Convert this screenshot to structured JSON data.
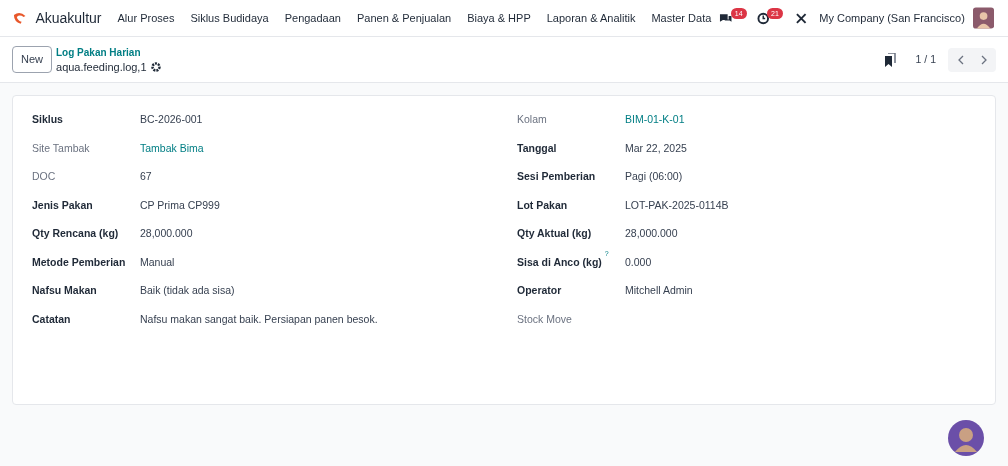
{
  "navbar": {
    "app_name": "Akuakultur",
    "menus": [
      "Alur Proses",
      "Siklus Budidaya",
      "Pengadaan",
      "Panen & Penjualan",
      "Biaya & HPP",
      "Laporan & Analitik",
      "Master Data"
    ],
    "messages_badge": "14",
    "activities_badge": "21",
    "company": "My Company (San Francisco)"
  },
  "control_panel": {
    "new_button": "New",
    "breadcrumb": "Log Pakan Harian",
    "record_name": "aqua.feeding.log,1",
    "pager": "1 / 1"
  },
  "left_fields": [
    {
      "label": "Siklus",
      "required": true,
      "value": "BC-2026-001",
      "link": false
    },
    {
      "label": "Site Tambak",
      "required": false,
      "value": "Tambak Bima",
      "link": true
    },
    {
      "label": "DOC",
      "required": false,
      "value": "67",
      "link": false
    },
    {
      "label": "Jenis Pakan",
      "required": true,
      "value": "CP Prima CP999",
      "link": false
    },
    {
      "label": "Qty Rencana (kg)",
      "required": true,
      "value": "28,000.000",
      "link": false
    },
    {
      "label": "Metode Pemberian",
      "required": true,
      "value": "Manual",
      "link": false
    },
    {
      "label": "Nafsu Makan",
      "required": true,
      "value": "Baik (tidak ada sisa)",
      "link": false
    },
    {
      "label": "Catatan",
      "required": true,
      "value": "Nafsu makan sangat baik. Persiapan panen besok.",
      "link": false
    }
  ],
  "right_fields": [
    {
      "label": "Kolam",
      "required": false,
      "value": "BIM-01-K-01",
      "link": true
    },
    {
      "label": "Tanggal",
      "required": true,
      "value": "Mar 22, 2025",
      "link": false
    },
    {
      "label": "Sesi Pemberian",
      "required": true,
      "value": "Pagi (06:00)",
      "link": false
    },
    {
      "label": "Lot Pakan",
      "required": true,
      "value": "LOT-PAK-2025-0114B",
      "link": false
    },
    {
      "label": "Qty Aktual (kg)",
      "required": true,
      "value": "28,000.000",
      "link": false
    },
    {
      "label": "Sisa di Anco (kg)",
      "required": true,
      "help": "?",
      "value": "0.000",
      "link": false
    },
    {
      "label": "Operator",
      "required": true,
      "value": "Mitchell Admin",
      "link": false
    },
    {
      "label": "Stock Move",
      "required": false
    }
  ]
}
